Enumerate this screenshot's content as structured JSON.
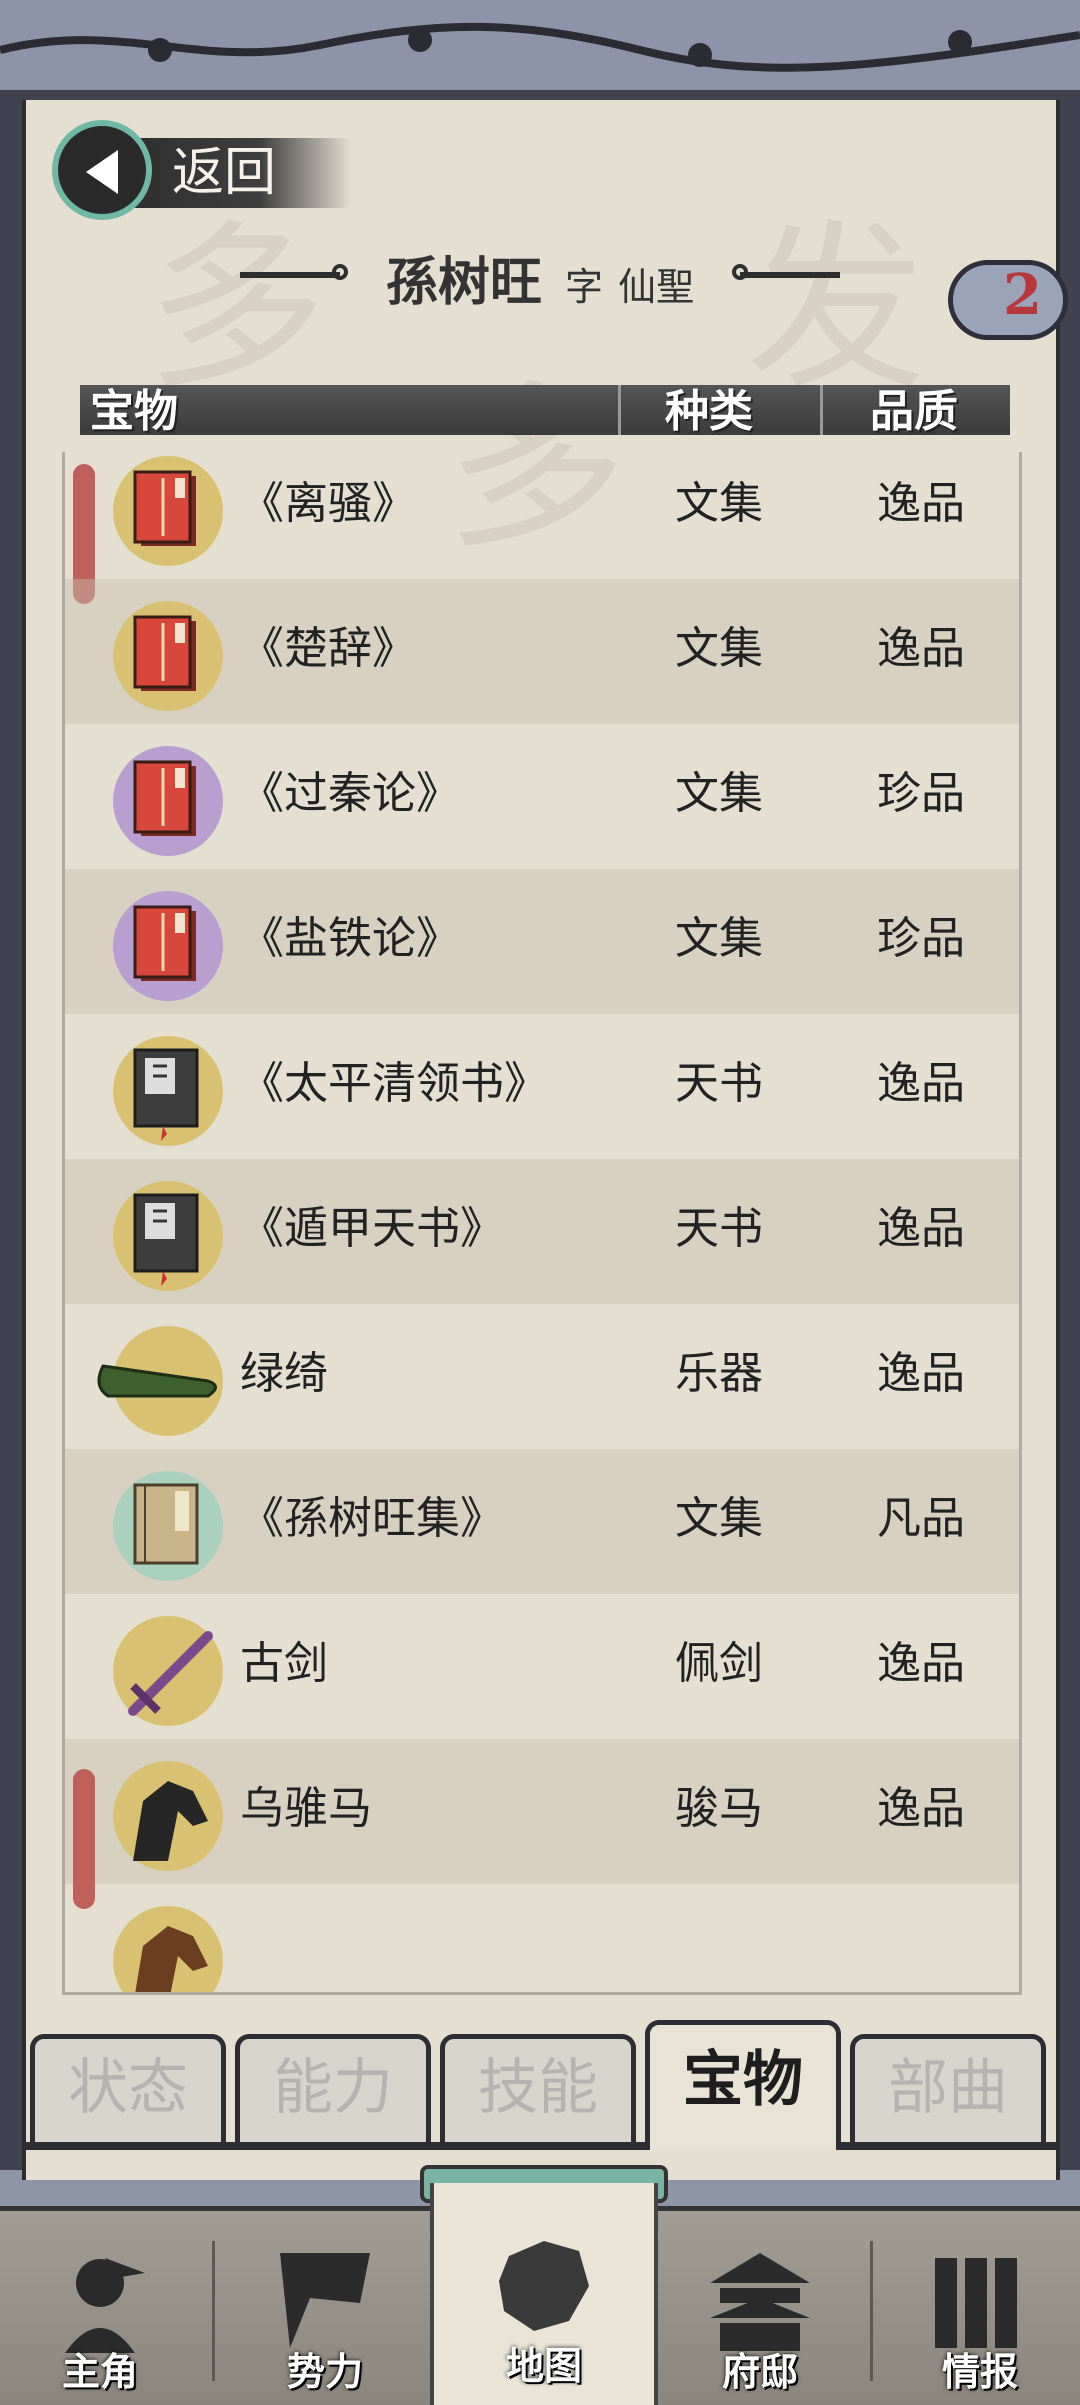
{
  "header": {
    "back_label": "返回",
    "name": "孫树旺",
    "zi_label": "字",
    "alias": "仙聖",
    "badge_count": "2"
  },
  "table": {
    "columns": [
      "宝物",
      "种类",
      "品质"
    ]
  },
  "rows": [
    {
      "name": "《离骚》",
      "type": "文集",
      "quality": "逸品",
      "icon": "red-book-icon",
      "icon_bg": "#d8c271",
      "marked": true
    },
    {
      "name": "《楚辞》",
      "type": "文集",
      "quality": "逸品",
      "icon": "red-book-icon",
      "icon_bg": "#d8c271",
      "marked": false
    },
    {
      "name": "《过秦论》",
      "type": "文集",
      "quality": "珍品",
      "icon": "red-book-icon",
      "icon_bg": "#b89fd0",
      "marked": false
    },
    {
      "name": "《盐铁论》",
      "type": "文集",
      "quality": "珍品",
      "icon": "red-book-icon",
      "icon_bg": "#b89fd0",
      "marked": false
    },
    {
      "name": "《太平清领书》",
      "type": "天书",
      "quality": "逸品",
      "icon": "dark-book-icon",
      "icon_bg": "#d8c271",
      "marked": false
    },
    {
      "name": "《遁甲天书》",
      "type": "天书",
      "quality": "逸品",
      "icon": "dark-book-icon",
      "icon_bg": "#d8c271",
      "marked": false
    },
    {
      "name": "绿绮",
      "type": "乐器",
      "quality": "逸品",
      "icon": "guqin-icon",
      "icon_bg": "#d8c271",
      "marked": false
    },
    {
      "name": "《孫树旺集》",
      "type": "文集",
      "quality": "凡品",
      "icon": "tan-book-icon",
      "icon_bg": "#a9d1bd",
      "marked": false
    },
    {
      "name": "古剑",
      "type": "佩剑",
      "quality": "逸品",
      "icon": "sword-icon",
      "icon_bg": "#d8c271",
      "marked": false
    },
    {
      "name": "乌骓马",
      "type": "骏马",
      "quality": "逸品",
      "icon": "black-horse-icon",
      "icon_bg": "#d8c271",
      "marked": true
    },
    {
      "name": "",
      "type": "",
      "quality": "",
      "icon": "brown-horse-icon",
      "icon_bg": "#d8c271",
      "marked": false
    }
  ],
  "tabs": [
    {
      "label": "状态",
      "active": false
    },
    {
      "label": "能力",
      "active": false
    },
    {
      "label": "技能",
      "active": false
    },
    {
      "label": "宝物",
      "active": true
    },
    {
      "label": "部曲",
      "active": false
    }
  ],
  "nav": [
    {
      "label": "主角",
      "icon": "warrior-icon",
      "active": false
    },
    {
      "label": "势力",
      "icon": "flag-icon",
      "active": false
    },
    {
      "label": "地图",
      "icon": "map-icon",
      "active": true
    },
    {
      "label": "府邸",
      "icon": "mansion-icon",
      "active": false
    },
    {
      "label": "情报",
      "icon": "scroll-icon",
      "active": false
    }
  ]
}
